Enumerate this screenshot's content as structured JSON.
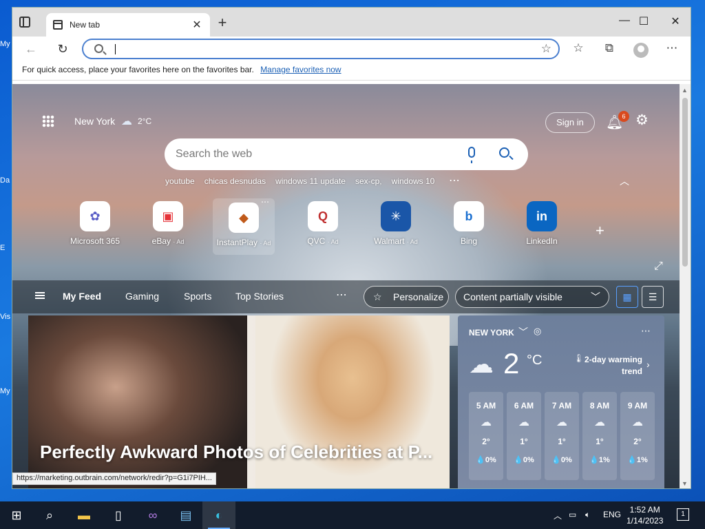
{
  "desktop": {
    "labels": [
      "My",
      "Da",
      "E",
      "Vis",
      "My"
    ]
  },
  "tab": {
    "title": "New tab",
    "close": "✕",
    "new": "+"
  },
  "window": {
    "minimize": "—",
    "maximize": "☐",
    "close": "✕"
  },
  "toolbar": {
    "back": "←",
    "refresh": "↻",
    "address_value": "",
    "fav_add": "☆",
    "favorites": "☆",
    "collections": "⧉",
    "more": "⋯"
  },
  "favbar": {
    "text": "For quick access, place your favorites here on the favorites bar.",
    "link": "Manage favorites now"
  },
  "header": {
    "location": "New York",
    "temp": "2°C",
    "signin": "Sign in",
    "badge": "6"
  },
  "search": {
    "placeholder": "Search the web"
  },
  "trending": [
    "youtube",
    "chicas desnudas",
    "windows 11 update",
    "sex-cp,",
    "windows 10"
  ],
  "tiles": [
    {
      "label": "Microsoft 365",
      "ad": "",
      "icon": "✿",
      "color": "#5b5fc7"
    },
    {
      "label": "eBay",
      "ad": "· Ad",
      "icon": "▣",
      "color": "#e53238"
    },
    {
      "label": "InstantPlay",
      "ad": "· Ad",
      "icon": "◆",
      "color": "#c05a1a"
    },
    {
      "label": "QVC",
      "ad": "· Ad",
      "icon": "Q",
      "color": "#c03030"
    },
    {
      "label": "Walmart",
      "ad": "· Ad",
      "icon": "✳",
      "color": "#1a56a8"
    },
    {
      "label": "Bing",
      "ad": "",
      "icon": "b",
      "color": "#1a6fd0"
    },
    {
      "label": "LinkedIn",
      "ad": "",
      "icon": "in",
      "color": "#0a66c2"
    }
  ],
  "feed": {
    "tabs": [
      "My Feed",
      "Gaming",
      "Sports",
      "Top Stories"
    ],
    "more": "⋯",
    "personalize": "Personalize",
    "content_filter": "Content partially visible"
  },
  "article": {
    "headline": "Perfectly Awkward Photos of Celebrities at P..."
  },
  "weather": {
    "city": "NEW YORK",
    "temp": "2",
    "unit": "°C",
    "trend": "2-day warming trend",
    "hourly": [
      {
        "time": "5 AM",
        "temp": "2°",
        "precip": "💧0%"
      },
      {
        "time": "6 AM",
        "temp": "1°",
        "precip": "💧0%"
      },
      {
        "time": "7 AM",
        "temp": "1°",
        "precip": "💧0%"
      },
      {
        "time": "8 AM",
        "temp": "1°",
        "precip": "💧1%"
      },
      {
        "time": "9 AM",
        "temp": "2°",
        "precip": "💧1%"
      }
    ]
  },
  "status_url": "https://marketing.outbrain.com/network/redir?p=G1i7PIH...",
  "taskbar": {
    "language": "ENG",
    "time": "1:52 AM",
    "date": "1/14/2023",
    "notification_count": "1"
  }
}
